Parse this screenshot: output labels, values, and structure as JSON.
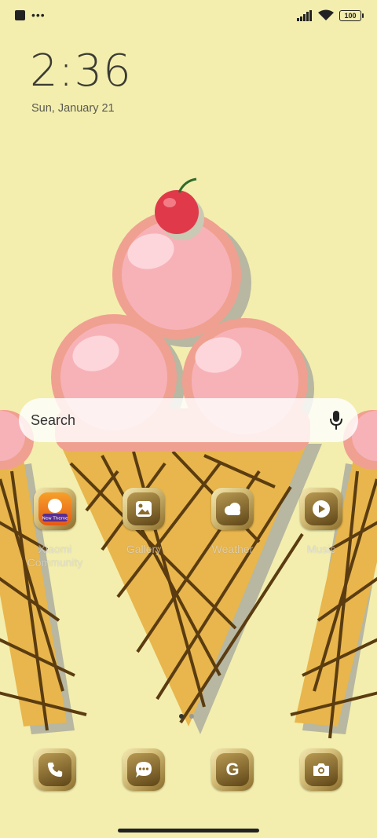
{
  "status_bar": {
    "battery": "100"
  },
  "lock": {
    "time": "2:36",
    "date": "Sun, January 21"
  },
  "search": {
    "placeholder": "Search"
  },
  "apps": [
    {
      "label": "Xiaomi Community",
      "icon": "xiaomi-community-icon",
      "badge": "New Theme"
    },
    {
      "label": "Gallery",
      "icon": "gallery-icon"
    },
    {
      "label": "Weather",
      "icon": "weather-icon"
    },
    {
      "label": "Music",
      "icon": "music-icon"
    }
  ],
  "dock": [
    {
      "icon": "phone-icon"
    },
    {
      "icon": "messages-icon"
    },
    {
      "icon": "google-icon",
      "glyph": "G"
    },
    {
      "icon": "camera-icon"
    }
  ],
  "colors": {
    "background": "#f3eeae",
    "cone": "#e8b64c",
    "scoop": "#f7b2b8",
    "cherry": "#e03a4a"
  }
}
